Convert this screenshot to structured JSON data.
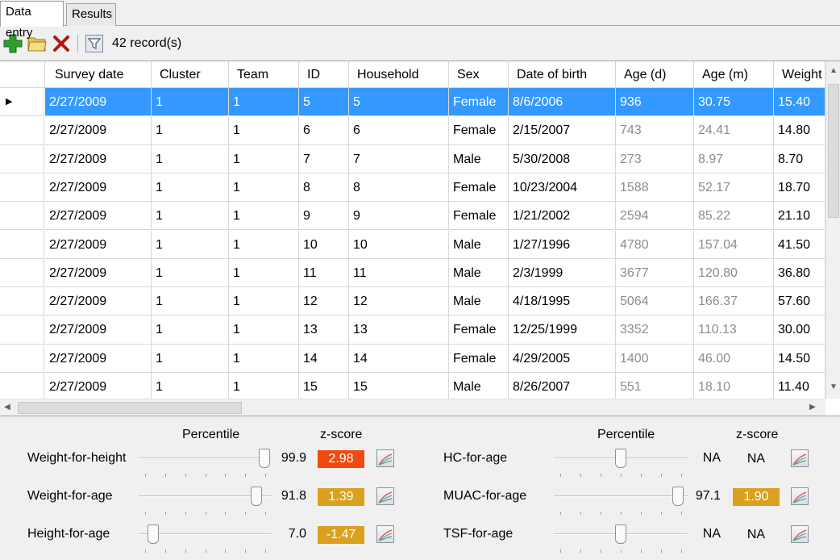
{
  "tabs": [
    {
      "label": "Data entry",
      "active": true
    },
    {
      "label": "Results",
      "active": false
    }
  ],
  "toolbar": {
    "record_count": "42 record(s)",
    "icons": [
      "add-record-icon",
      "open-folder-icon",
      "delete-icon",
      "filter-icon"
    ]
  },
  "grid": {
    "columns": [
      "Survey date",
      "Cluster",
      "Team",
      "ID",
      "Household",
      "Sex",
      "Date of birth",
      "Age (d)",
      "Age (m)",
      "Weight"
    ],
    "selected_row": 0,
    "rows": [
      [
        "2/27/2009",
        "1",
        "1",
        "5",
        "5",
        "Female",
        "8/6/2006",
        "936",
        "30.75",
        "15.40"
      ],
      [
        "2/27/2009",
        "1",
        "1",
        "6",
        "6",
        "Female",
        "2/15/2007",
        "743",
        "24.41",
        "14.80"
      ],
      [
        "2/27/2009",
        "1",
        "1",
        "7",
        "7",
        "Male",
        "5/30/2008",
        "273",
        "8.97",
        "8.70"
      ],
      [
        "2/27/2009",
        "1",
        "1",
        "8",
        "8",
        "Female",
        "10/23/2004",
        "1588",
        "52.17",
        "18.70"
      ],
      [
        "2/27/2009",
        "1",
        "1",
        "9",
        "9",
        "Female",
        "1/21/2002",
        "2594",
        "85.22",
        "21.10"
      ],
      [
        "2/27/2009",
        "1",
        "1",
        "10",
        "10",
        "Male",
        "1/27/1996",
        "4780",
        "157.04",
        "41.50"
      ],
      [
        "2/27/2009",
        "1",
        "1",
        "11",
        "11",
        "Male",
        "2/3/1999",
        "3677",
        "120.80",
        "36.80"
      ],
      [
        "2/27/2009",
        "1",
        "1",
        "12",
        "12",
        "Male",
        "4/18/1995",
        "5064",
        "166.37",
        "57.60"
      ],
      [
        "2/27/2009",
        "1",
        "1",
        "13",
        "13",
        "Female",
        "12/25/1999",
        "3352",
        "110.13",
        "30.00"
      ],
      [
        "2/27/2009",
        "1",
        "1",
        "14",
        "14",
        "Female",
        "4/29/2005",
        "1400",
        "46.00",
        "14.50"
      ],
      [
        "2/27/2009",
        "1",
        "1",
        "15",
        "15",
        "Male",
        "8/26/2007",
        "551",
        "18.10",
        "11.40"
      ]
    ]
  },
  "panel": {
    "percentile_header": "Percentile",
    "zscore_header": "z-score",
    "left": [
      {
        "label": "Weight-for-height",
        "percentile": "99.9",
        "zscore": "2.98",
        "z_color": "#f04a10",
        "slider_fraction": 0.99
      },
      {
        "label": "Weight-for-age",
        "percentile": "91.8",
        "zscore": "1.39",
        "z_color": "#dca020",
        "slider_fraction": 0.92
      },
      {
        "label": "Height-for-age",
        "percentile": "7.0",
        "zscore": "-1.47",
        "z_color": "#dca020",
        "slider_fraction": 0.07
      }
    ],
    "right": [
      {
        "label": "HC-for-age",
        "percentile": "NA",
        "zscore": "NA",
        "z_color": "",
        "slider_fraction": 0.5
      },
      {
        "label": "MUAC-for-age",
        "percentile": "97.1",
        "zscore": "1.90",
        "z_color": "#dca020",
        "slider_fraction": 0.97
      },
      {
        "label": "TSF-for-age",
        "percentile": "NA",
        "zscore": "NA",
        "z_color": "",
        "slider_fraction": 0.5
      }
    ]
  },
  "colors": {
    "selection": "#3399ff",
    "add_icon": "#2e9e2e",
    "delete_icon": "#b01818"
  }
}
